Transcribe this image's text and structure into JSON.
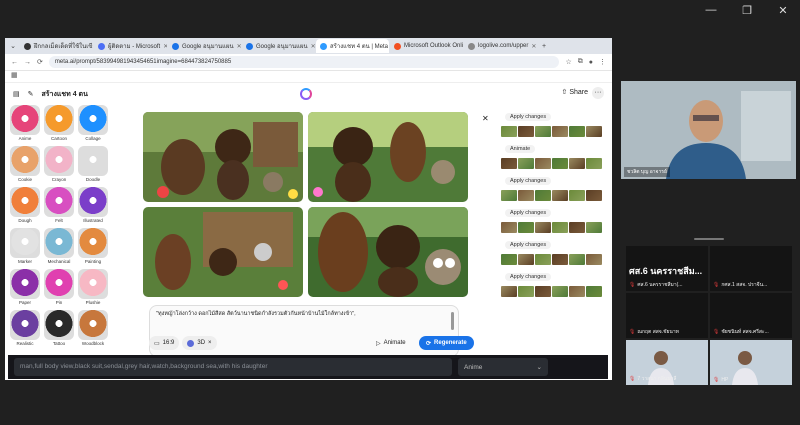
{
  "window_controls": [
    "—",
    "❐",
    "✕"
  ],
  "browser": {
    "tabs": [
      {
        "label": "ฝึกกลเม็ดเด็ดที่ใช้ในเขียโ",
        "color": "#333333",
        "active": false
      },
      {
        "label": "ผู้ติดตาม - Microsoft",
        "color": "#4c6ef5",
        "active": false
      },
      {
        "label": "Google อนุมานแผน",
        "color": "#1a73e8",
        "active": false
      },
      {
        "label": "Google อนุมานแผน",
        "color": "#1a73e8",
        "active": false
      },
      {
        "label": "สร้างแชท 4 ตน | Meta AI",
        "color": "#2f9bff",
        "active": true
      },
      {
        "label": "Microsoft Outlook Online",
        "color": "#f25022",
        "active": false
      },
      {
        "label": "logolive.com/upper",
        "color": "#888888",
        "active": false
      }
    ],
    "url": "meta.ai/prompt/583994981943454651imagine=684473824750885",
    "app_title": "สร้างแชท 4 ตน",
    "share_label": "Share",
    "more_label": "···"
  },
  "styles": [
    {
      "label": "Anime",
      "color": "#e6457a"
    },
    {
      "label": "Cartoon",
      "color": "#f59a2c"
    },
    {
      "label": "Collage",
      "color": "#1e90ff"
    },
    {
      "label": "Cookie",
      "color": "#e8a26a"
    },
    {
      "label": "Crayon",
      "color": "#f2b3c8"
    },
    {
      "label": "Doodle",
      "color": "#dddddd"
    },
    {
      "label": "Dough",
      "color": "#f07f3a"
    },
    {
      "label": "Felt",
      "color": "#d84fc1"
    },
    {
      "label": "Illustrated",
      "color": "#7b3ec9"
    },
    {
      "label": "Marker",
      "color": "#e2e2e2"
    },
    {
      "label": "Mechanical",
      "color": "#7ab8d4"
    },
    {
      "label": "Painting",
      "color": "#e38a3f"
    },
    {
      "label": "Paper",
      "color": "#8b2fa8"
    },
    {
      "label": "Pin",
      "color": "#e040b0"
    },
    {
      "label": "Plushie",
      "color": "#f7b8c4"
    },
    {
      "label": "Realistic",
      "color": "#6b3fa0"
    },
    {
      "label": "Tattoo",
      "color": "#2a2a2a"
    },
    {
      "label": "Woodblock",
      "color": "#c7773c"
    }
  ],
  "moods_label": "Moods",
  "prompt_text": "\"ทุงหญ้าโล่งกว้าง ดอกไม้สีสด สัตว์นานาชนิดกำลังรวมตัวกันหน้าบ้านไม้ใกล้ทางเข้า\",",
  "controls": {
    "aspect_label": "16:9",
    "style_label": "3D",
    "style_remove": "×",
    "animate_label": "Animate",
    "regenerate_label": "Regenerate"
  },
  "history": [
    {
      "label": "Apply changes"
    },
    {
      "label": "Animate"
    },
    {
      "label": "Apply changes"
    },
    {
      "label": "Apply changes"
    },
    {
      "label": "Apply changes"
    },
    {
      "label": "Apply changes"
    }
  ],
  "bottom_prompt": {
    "input_value": "man,full body view,black suit,sendal,grey hair,watch,background sea,with his daughter",
    "select_value": "Anime"
  },
  "main_speaker_name": "ชวลิต บุญ อาจารย์",
  "participants": [
    {
      "name": "ศส.6 นครราชสีมา(...",
      "tile_title": "ศส.6 นครราชสีม...",
      "type": "text"
    },
    {
      "name": "กศส.1 สสจ. ปราจีน...",
      "type": "blank"
    },
    {
      "name": "ณกฤต สสจ.ชัยนาท",
      "type": "blank"
    },
    {
      "name": "ชัยชนินท์ สสจ.ศรีสะ...",
      "type": "blank"
    },
    {
      "name": "7 วาสนา กลิ่นมาลี",
      "type": "photo"
    },
    {
      "name": "HP",
      "type": "photo"
    }
  ]
}
